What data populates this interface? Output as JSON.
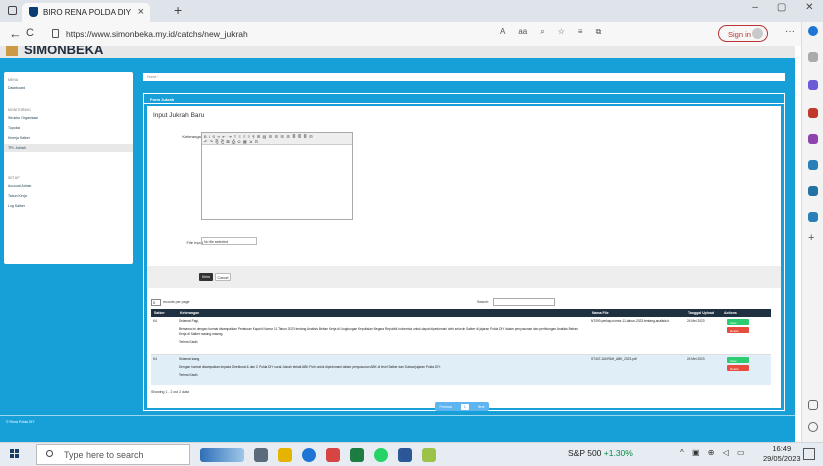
{
  "browser": {
    "tab_title": "BIRO RENA POLDA DIY",
    "tab_close": "×",
    "new_tab": "+",
    "url": "https://www.simonbeka.my.id/catchs/new_jukrah",
    "sign_in": "Sign in",
    "more": "···",
    "min": "–",
    "max": "▢",
    "close": "✕",
    "back": "←",
    "reload": "C"
  },
  "app": {
    "brand": "SIMONBEKA",
    "breadcrumb": "Home /",
    "sidebar": {
      "menu_heading": "MENU",
      "dashboard": "Dashboard",
      "monitoring_heading": "MONITORING",
      "items": [
        "Struktur Organisasi",
        "Tupoksi",
        "Kinerja Satker",
        "TPL Jukrah"
      ],
      "setup_heading": "SETUP",
      "setup_items": [
        "Account Admin",
        "Tahun Kerja",
        "Log Satker"
      ]
    },
    "card_title": "Form Jukrah",
    "form_title": "Input Jukrah Baru",
    "label_keterangan": "Keterangan",
    "label_file": "File Input",
    "file_placeholder": "No file selected",
    "save_label": "Kirim",
    "cancel_label": "Cancel",
    "length_value": "5",
    "length_label": "records per page",
    "search_label": "Search:",
    "columns": [
      "Satker",
      "Keterangan",
      "Nama File",
      "Tanggal Upload",
      "Actions"
    ],
    "rows": [
      {
        "satker": "K4",
        "lines": [
          "Selamat Pagi,",
          "Bersama ini dengan hormat disampaikan Peraturan Kapolri Nomor 11 Tahun 2023 tentang Analisis Beban Kerja di Lingkungan Kepolisian Negara Republik Indonesia untuk dapat dipedomani oleh seluruh Satker di jajaran Polda DIY dalam penyusunan dan perhitungan Analisis Beban Kerja di Satker masing-masing.",
          "Terima Kasih."
        ],
        "file": "NT090-perkap-nomor-11-tahun-2023-tentang-analisis-b",
        "date": "24 Mei 2023",
        "view": "View",
        "delete": "Delete"
      },
      {
        "satker": "K4",
        "lines": [
          "Selamat siang,",
          "Dengan hormat disampaikan kepada Direktorat & dan C Polda DIY surat Jukrah terkait ABK Polri untuk dipedomani dalam penyusunan ABK di level Satker dan Subsat jajaran Polda DIY.",
          "Terima Kasih."
        ],
        "file": "ST447-JUKRAH_ABK_2023.pdf",
        "date": "24 Mei 2023",
        "view": "View",
        "delete": "Delete"
      }
    ],
    "info": "Showing 1 - 2 out 2 data",
    "pager": {
      "prev": "Previous",
      "current": "1",
      "next": "Next"
    },
    "footer": "© Rena Polda DIY"
  },
  "taskbar": {
    "search_placeholder": "Type here to search",
    "stock_name": "S&P 500",
    "stock_change": "+1.30%",
    "time": "16:49",
    "date": "29/05/2023"
  },
  "colors": {
    "accent": "#17a0d8",
    "header_dark": "#1f3040",
    "view": "#2ecc71",
    "delete": "#e74c3c"
  }
}
